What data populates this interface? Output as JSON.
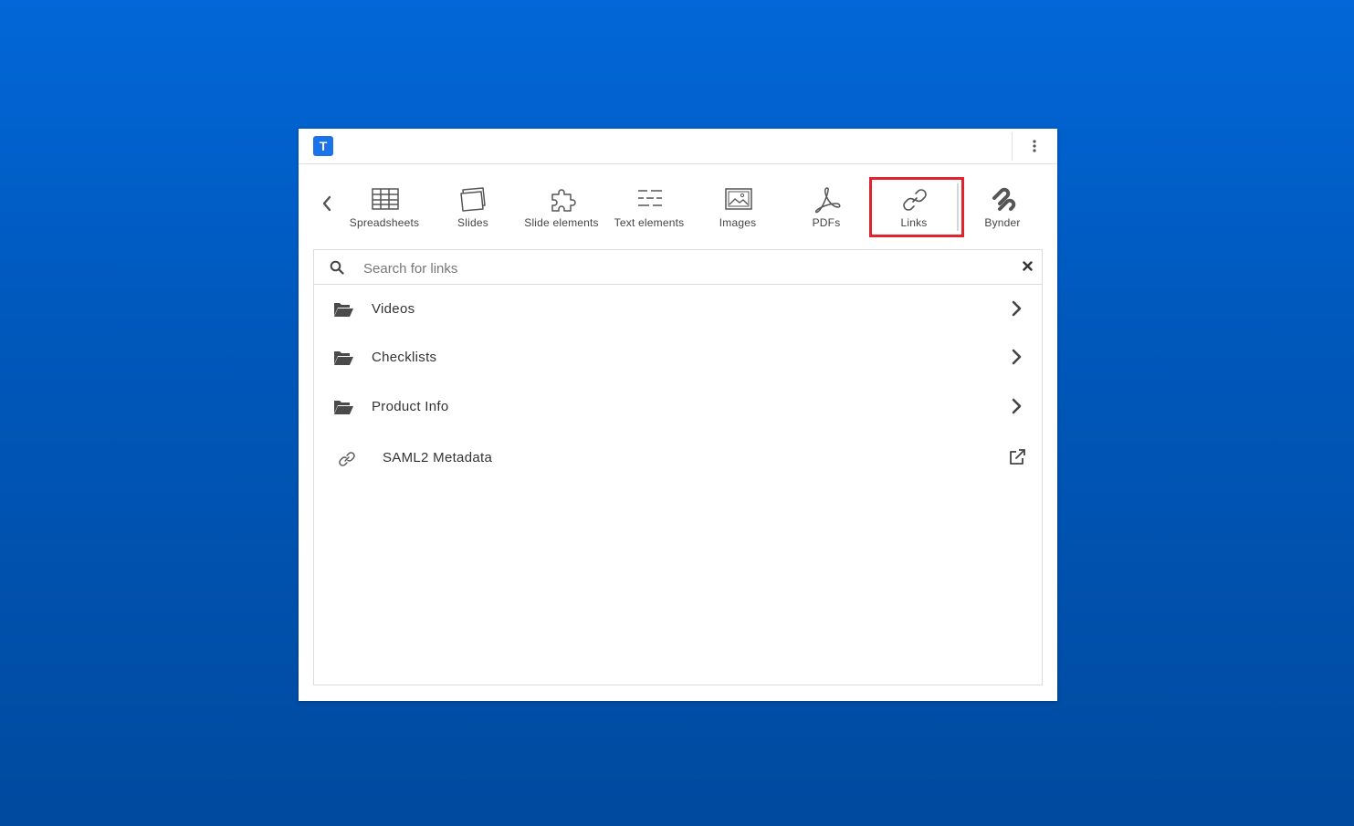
{
  "app": {
    "logo_letter": "T"
  },
  "toolbar": {
    "tools": [
      {
        "label": "Spreadsheets",
        "icon": "spreadsheet-icon"
      },
      {
        "label": "Slides",
        "icon": "slides-icon"
      },
      {
        "label": "Slide elements",
        "icon": "puzzle-icon"
      },
      {
        "label": "Text elements",
        "icon": "text-elements-icon"
      },
      {
        "label": "Images",
        "icon": "image-icon"
      },
      {
        "label": "PDFs",
        "icon": "pdf-icon"
      },
      {
        "label": "Links",
        "icon": "link-icon",
        "selected": true
      },
      {
        "label": "Bynder",
        "icon": "bynder-icon"
      }
    ]
  },
  "search": {
    "placeholder": "Search for links",
    "value": ""
  },
  "items": [
    {
      "label": "Videos",
      "type": "folder"
    },
    {
      "label": "Checklists",
      "type": "folder"
    },
    {
      "label": "Product Info",
      "type": "folder"
    },
    {
      "label": "SAML2 Metadata",
      "type": "link"
    }
  ],
  "colors": {
    "accent": "#1a73e8",
    "highlight": "#e0242f",
    "background": "#0261d0"
  }
}
